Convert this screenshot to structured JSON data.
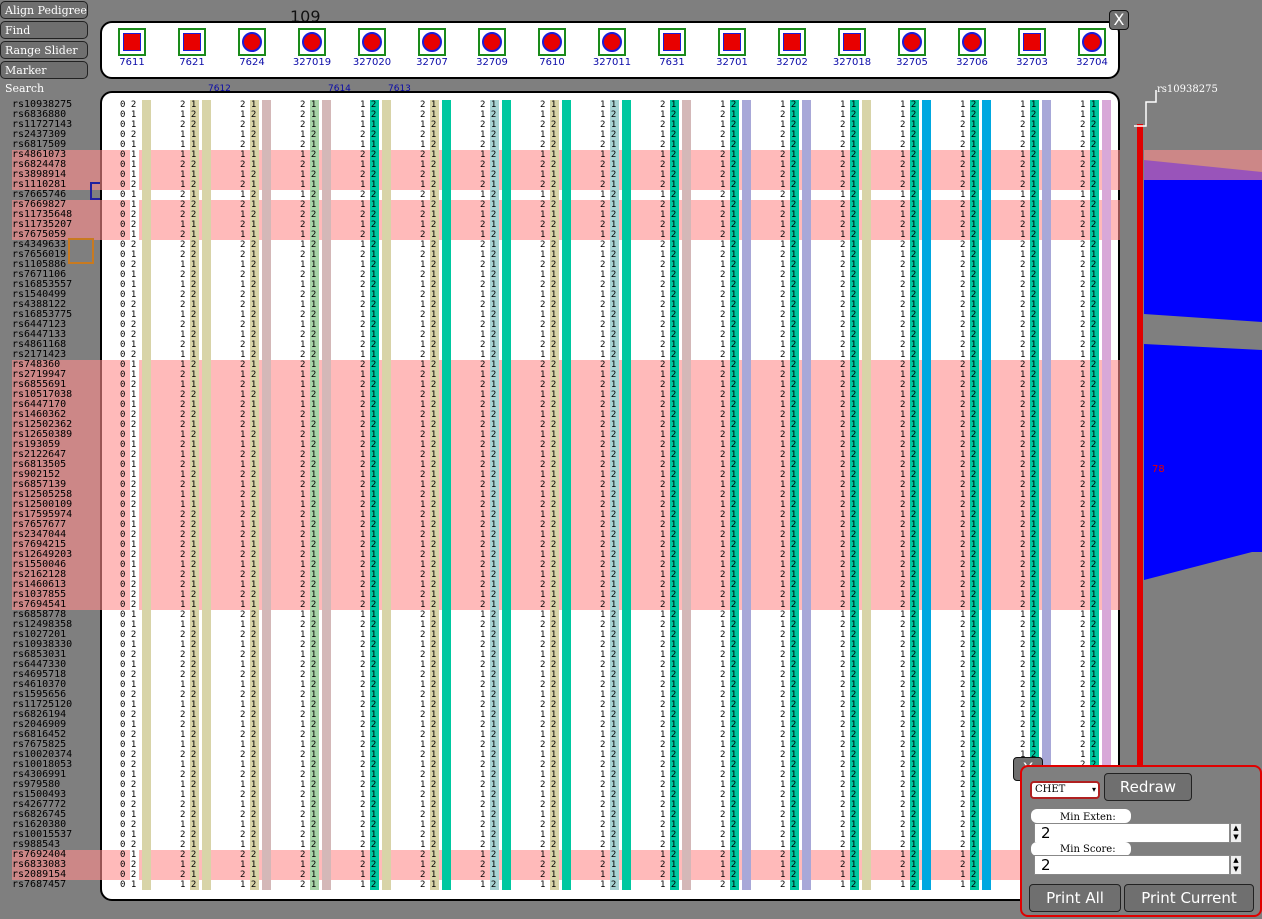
{
  "toolbar": {
    "buttons": [
      "Align Pedigree",
      "Find Homology",
      "Range Slider",
      "Marker Search"
    ]
  },
  "pedigree_count_label": "109",
  "pedigree": {
    "individuals": [
      {
        "id": "7611",
        "shape": "square"
      },
      {
        "id": "7621",
        "shape": "square"
      },
      {
        "id": "7624",
        "shape": "circle"
      },
      {
        "id": "327019",
        "shape": "circle"
      },
      {
        "id": "327020",
        "shape": "circle"
      },
      {
        "id": "32707",
        "shape": "circle"
      },
      {
        "id": "32709",
        "shape": "circle"
      },
      {
        "id": "7610",
        "shape": "circle"
      },
      {
        "id": "327011",
        "shape": "circle"
      },
      {
        "id": "7631",
        "shape": "square"
      },
      {
        "id": "32701",
        "shape": "square"
      },
      {
        "id": "32702",
        "shape": "square"
      },
      {
        "id": "327018",
        "shape": "square"
      },
      {
        "id": "32705",
        "shape": "circle"
      },
      {
        "id": "32706",
        "shape": "circle"
      },
      {
        "id": "32703",
        "shape": "square"
      },
      {
        "id": "32704",
        "shape": "circle"
      }
    ],
    "gap_labels": [
      "7612",
      "7614",
      "7613"
    ],
    "close_label": "X"
  },
  "markers": [
    "rs10938275",
    "rs6836880",
    "rs11727143",
    "rs2437309",
    "rs6817509",
    "rs4861073",
    "rs6824478",
    "rs3898914",
    "rs1110281",
    "rs7665746",
    "rs7669827",
    "rs11735648",
    "rs11735207",
    "rs7675059",
    "rs4349633",
    "rs7656019",
    "rs1105886",
    "rs7671106",
    "rs16853557",
    "rs1540499",
    "rs4388122",
    "rs16853775",
    "rs6447123",
    "rs6447133",
    "rs4861168",
    "rs2171423",
    "rs748360",
    "rs2719947",
    "rs6855691",
    "rs10517038",
    "rs6447170",
    "rs1460362",
    "rs12502362",
    "rs12650389",
    "rs193059",
    "rs2122647",
    "rs6813505",
    "rs902152",
    "rs6857139",
    "rs12505258",
    "rs12500109",
    "rs17595974",
    "rs7657677",
    "rs2347044",
    "rs7694215",
    "rs12649203",
    "rs1550046",
    "rs2162128",
    "rs1460613",
    "rs1037855",
    "rs7694541",
    "rs6858778",
    "rs12498358",
    "rs1027201",
    "rs10938330",
    "rs6853031",
    "rs6447330",
    "rs4695718",
    "rs4610370",
    "rs1595656",
    "rs11725120",
    "rs6826194",
    "rs2046909",
    "rs6816452",
    "rs7675825",
    "rs10020374",
    "rs10018053",
    "rs4306991",
    "rs979580",
    "rs1500493",
    "rs4267772",
    "rs6826745",
    "rs1620380",
    "rs10015537",
    "rs988543",
    "rs7692404",
    "rs6833083",
    "rs2089154",
    "rs7687457"
  ],
  "genotype_columns": [
    {
      "a": "00000000000000000000000000000000000000000000000000000000000000000000000000000",
      "b": "21121111211221212111212212112112211211222112121122211212121212121221212121212",
      "colors": [
        "#ffffff",
        "#d8d4a8"
      ]
    },
    {
      "a": "21211121122212221212212121121222212121211222221221121212221212211212112212221",
      "b": "12211121212211221222121211211212121112111222122112111221221211121212211212122",
      "colors": [
        "#d8d4a8",
        "#d8d4a8"
      ]
    },
    {
      "a": "21212121212121221212212121212122211212121212121212121212121212121212121212121",
      "b": "12121112121211212121121212121211121212121212121212121212121212121212121212121",
      "colors": [
        "#d8d4a8",
        "#d4b8b8"
      ]
    },
    {
      "a": "22212121112221121212121212211112121222211212121222212121221212121212121212121",
      "b": "11121212121212211112121212121211212121212121212121212121212121212121212121212",
      "colors": [
        "#a8d4a8",
        "#d4b8b8"
      ]
    },
    {
      "a": "11121212121212121221212121212121212121212121212121212121212121212121212121212",
      "b": "22121212121221212121212121212121212121212121212121212121212121212121212121212",
      "colors": [
        "#00c8a0",
        "#d8d4a8"
      ]
    },
    {
      "a": "22121212121212121212121212121212121212121212121212121212121212121212121212121",
      "b": "11212121212121212121212121212121212121212121212121212121212121212121212121212",
      "colors": [
        "#d8d4a8",
        "#00c8a0"
      ]
    },
    {
      "a": "21212121212121212121212121212121212121212121212121212121212121212121212121212",
      "b": "12121212121212121212121212121212121212121212121212121212121212121212121212121",
      "colors": [
        "#a8d4d4",
        "#00c8a0"
      ]
    },
    {
      "a": "21212121212121212121212121212121212121212121212121212121212121212121212121212",
      "b": "11212121212121212121212121212121212121212121212121212121212121212121212121212",
      "colors": [
        "#d8d4a8",
        "#00c8a0"
      ]
    },
    {
      "a": "11212121212121212121212121212121212121212121212121212121212121212121212121212",
      "b": "12121212121212121212121212121212121212121212121212121212121212121212121212121",
      "colors": [
        "#a8d4d4",
        "#00c8a0"
      ]
    },
    {
      "a": "21212121212121212121212121212121212121212121212121212121212121212121212121212",
      "b": "12121212121212121212121212121212121212121212121212121212121212121212121212121",
      "colors": [
        "#00c8a0",
        "#d4b8b8"
      ]
    },
    {
      "a": "12121212121212121212121212121212121212121212121212121212121212121212121212121",
      "b": "21212121212121212121212121212121212121212121212121212121212121212121212121212",
      "colors": [
        "#00c8a0",
        "#a8a8d8"
      ]
    },
    {
      "a": "12121212121212121212121212121212121212121212121212121212121212121212121212121",
      "b": "21212121212121212121212121212121212121212121212121212121212121212121212121212",
      "colors": [
        "#00c8a0",
        "#a8a8d8"
      ]
    },
    {
      "a": "11212121212121212121212121212121212121212121212121212121212121212121212121212",
      "b": "12121212121212121212121212121212121212121212121212121212121212121212121212121",
      "colors": [
        "#00c8a0",
        "#d8d4a8"
      ]
    },
    {
      "a": "11212121212121212121212121212121212121212121212121212121212121212121212121212",
      "b": "22121212121212121212121212121212121212121212121212121212121212121212121212121",
      "colors": [
        "#00c8a0",
        "#00a8e0"
      ]
    },
    {
      "a": "11212121212121212121212121212121212121212121212121212121212121212121212121212",
      "b": "22121212121212121212121212121212121212121212121212121212121212121212121212121",
      "colors": [
        "#00c8a0",
        "#00a8e0"
      ]
    },
    {
      "a": "11212121212121212121212121212121212121212121212121212121212121212121212121212",
      "b": "12121212121212121212121212121212121212121212121212121212121212121212121212121",
      "colors": [
        "#00c8a0",
        "#a8a8d8"
      ]
    },
    {
      "a": "11212121212121212121212121212121212121212121212121212121212121212121212121212",
      "b": "11212121212121212121212121212121212121212121212121212121212121212121212121212",
      "colors": [
        "#00c8a0",
        "#d8a8d8"
      ]
    }
  ],
  "right_panel": {
    "marker_label": "rs10938275",
    "score_label": "78"
  },
  "controls": {
    "close_label": "X",
    "mode": "CHET",
    "redraw_label": "Redraw",
    "min_extent_label": "Min Exten:",
    "min_extent_value": "2",
    "min_score_label": "Min Score:",
    "min_score_value": "2",
    "print_all_label": "Print All",
    "print_current_label": "Print Current"
  },
  "colors": {
    "highlight": "#ff8c8c",
    "score_fill": "#0000ff",
    "slider": "#e00000",
    "node_fill": "#e80000",
    "node_border": "#1a8a1a"
  }
}
